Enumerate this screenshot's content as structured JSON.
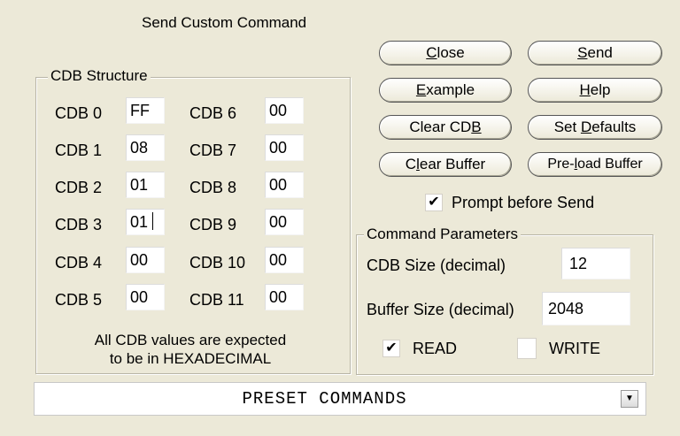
{
  "dialog": {
    "title": "Send Custom Command"
  },
  "cdb_structure": {
    "label": "CDB Structure",
    "fields": [
      {
        "label": "CDB 0",
        "value": "FF"
      },
      {
        "label": "CDB 1",
        "value": "08"
      },
      {
        "label": "CDB 2",
        "value": "01"
      },
      {
        "label": "CDB 3",
        "value": "01"
      },
      {
        "label": "CDB 4",
        "value": "00"
      },
      {
        "label": "CDB 5",
        "value": "00"
      },
      {
        "label": "CDB 6",
        "value": "00"
      },
      {
        "label": "CDB 7",
        "value": "00"
      },
      {
        "label": "CDB 8",
        "value": "00"
      },
      {
        "label": "CDB 9",
        "value": "00"
      },
      {
        "label": "CDB 10",
        "value": "00"
      },
      {
        "label": "CDB 11",
        "value": "00"
      }
    ],
    "note_line1": "All CDB values are expected",
    "note_line2": "to be in HEXADECIMAL"
  },
  "buttons": {
    "close": {
      "pre": "",
      "key": "C",
      "post": "lose"
    },
    "send": {
      "pre": "",
      "key": "S",
      "post": "end"
    },
    "example": {
      "pre": "",
      "key": "E",
      "post": "xample"
    },
    "help": {
      "pre": "",
      "key": "H",
      "post": "elp"
    },
    "clear_cdb": {
      "pre": "Clear CD",
      "key": "B",
      "post": ""
    },
    "set_defaults": {
      "pre": "Set ",
      "key": "D",
      "post": "efaults"
    },
    "clear_buffer": {
      "pre": "C",
      "key": "l",
      "post": "ear Buffer"
    },
    "preload_buffer": {
      "pre": "Pre-",
      "key": "l",
      "post": "oad Buffer"
    }
  },
  "prompt_before_send": {
    "label": "Prompt before Send",
    "checked": "✔"
  },
  "command_parameters": {
    "label": "Command Parameters",
    "cdb_size_label": "CDB Size (decimal)",
    "cdb_size_value": "12",
    "buffer_size_label": "Buffer Size (decimal)",
    "buffer_size_value": "2048",
    "read_label": "READ",
    "read_checked": "✔",
    "write_label": "WRITE",
    "write_checked": ""
  },
  "preset": {
    "selected": "PRESET COMMANDS",
    "arrow": "▼"
  }
}
